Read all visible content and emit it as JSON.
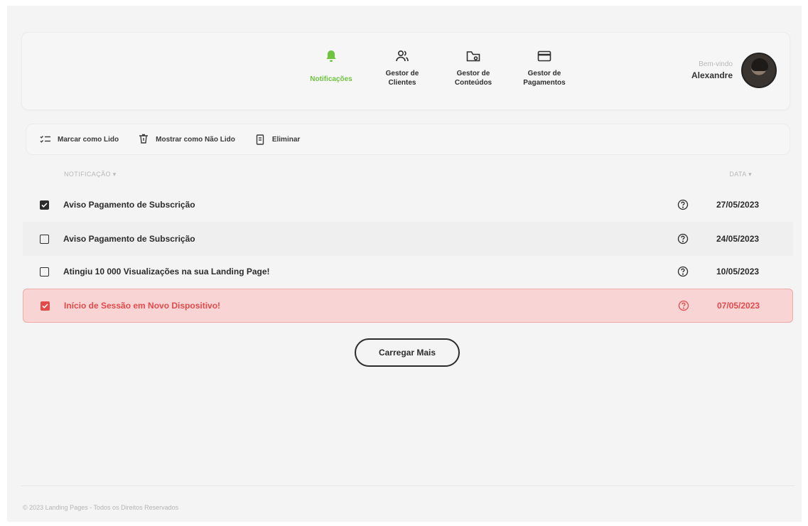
{
  "nav": {
    "items": [
      {
        "label": "Notificações",
        "icon": "bell-icon",
        "active": true
      },
      {
        "label": "Gestor de\nClientes",
        "icon": "users-icon",
        "active": false
      },
      {
        "label": "Gestor de\nConteúdos",
        "icon": "folder-icon",
        "active": false
      },
      {
        "label": "Gestor de\nPagamentos",
        "icon": "credit-card-icon",
        "active": false
      }
    ]
  },
  "user": {
    "welcome": "Bem-vindo",
    "name": "Alexandre"
  },
  "toolbar": {
    "mark_read": "Marcar como Lido",
    "mark_unread": "Mostrar como Não Lido",
    "delete": "Eliminar"
  },
  "table": {
    "col_notification": "NOTIFICAÇÃO ▾",
    "col_date": "DATA ▾",
    "rows": [
      {
        "title": "Aviso Pagamento de Subscrição",
        "date": "27/05/2023",
        "checked": true,
        "highlight": false
      },
      {
        "title": "Aviso Pagamento de Subscrição",
        "date": "24/05/2023",
        "checked": false,
        "highlight": false
      },
      {
        "title": "Atingiu 10 000 Visualizações na sua Landing Page!",
        "date": "10/05/2023",
        "checked": false,
        "highlight": false
      },
      {
        "title": "Início de Sessão em Novo Dispositivo!",
        "date": "07/05/2023",
        "checked": true,
        "highlight": true
      }
    ]
  },
  "load_more": "Carregar Mais",
  "footer": "© 2023 Landing Pages - Todos os Direitos Reservados",
  "colors": {
    "accent": "#6ec43f",
    "alert": "#e34a4a",
    "alert_bg": "#f8d4d4"
  }
}
